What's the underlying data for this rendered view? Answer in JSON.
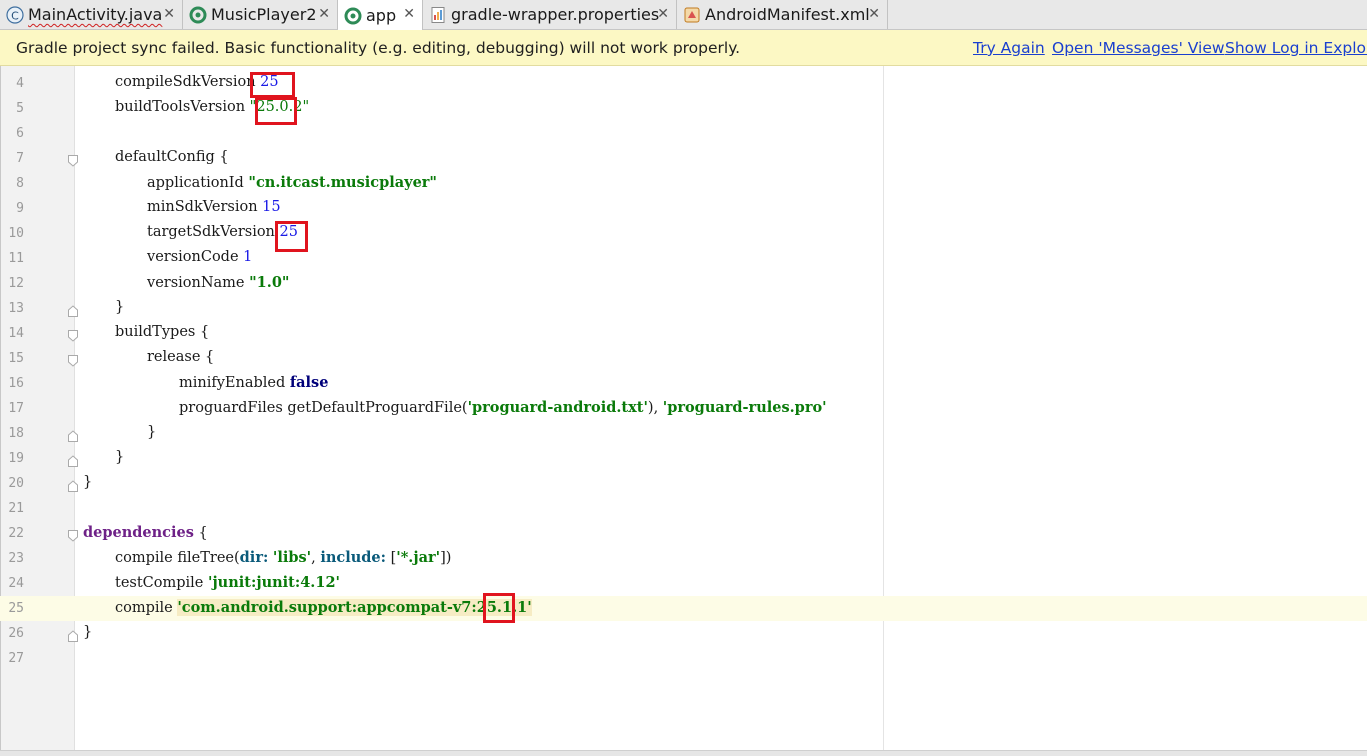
{
  "tabs": [
    {
      "label": "MainActivity.java",
      "icon": "class-c-icon",
      "active": false,
      "error": true
    },
    {
      "label": "MusicPlayer2",
      "icon": "gradle-module-icon",
      "active": false
    },
    {
      "label": "app",
      "icon": "gradle-module-icon",
      "active": true
    },
    {
      "label": "gradle-wrapper.properties",
      "icon": "properties-file-icon",
      "active": false
    },
    {
      "label": "AndroidManifest.xml",
      "icon": "manifest-file-icon",
      "active": false
    }
  ],
  "notification": {
    "message": "Gradle project sync failed. Basic functionality (e.g. editing, debugging) will not work properly.",
    "try_again": "Try Again",
    "open_messages": "Open 'Messages' View",
    "show_log": "Show Log in Explorer"
  },
  "line_numbers": [
    "4",
    "5",
    "6",
    "7",
    "8",
    "9",
    "10",
    "11",
    "12",
    "13",
    "14",
    "15",
    "16",
    "17",
    "18",
    "19",
    "20",
    "21",
    "22",
    "23",
    "24",
    "25",
    "26",
    "27"
  ],
  "code": {
    "l4": {
      "t1": "compileSdkVersion ",
      "n1": "25"
    },
    "l5": {
      "t1": "buildToolsVersion ",
      "s1": "\"25.0.2\""
    },
    "l7": {
      "t1": "defaultConfig {"
    },
    "l8": {
      "t1": "applicationId ",
      "s1": "\"cn.itcast.musicplayer\""
    },
    "l9": {
      "t1": "minSdkVersion ",
      "n1": "15"
    },
    "l10": {
      "t1": "targetSdkVersion ",
      "n1": "25"
    },
    "l11": {
      "t1": "versionCode ",
      "n1": "1"
    },
    "l12": {
      "t1": "versionName ",
      "s1": "\"1.0\""
    },
    "l13": {
      "t1": "}"
    },
    "l14": {
      "t1": "buildTypes {"
    },
    "l15": {
      "t1": "release {"
    },
    "l16": {
      "t1": "minifyEnabled ",
      "k1": "false"
    },
    "l17": {
      "t1": "proguardFiles getDefaultProguardFile(",
      "s1": "'proguard-android.txt'",
      "t2": "), ",
      "s2": "'proguard-rules.pro'"
    },
    "l18": {
      "t1": "}"
    },
    "l19": {
      "t1": "}"
    },
    "l20": {
      "t1": "}"
    },
    "l22": {
      "d1": "dependencies",
      "t1": " {"
    },
    "l23": {
      "t1": "compile fileTree(",
      "k1": "dir:",
      "t2": " ",
      "s1": "'libs'",
      "t3": ", ",
      "k2": "include:",
      "t4": " [",
      "s2": "'*.jar'",
      "t5": "])"
    },
    "l24": {
      "t1": "testCompile ",
      "s1": "'junit:junit:4.12'"
    },
    "l25": {
      "t1": "compile ",
      "s1": "'com.android.support:appcompat-v7:25.1.1'"
    },
    "l26": {
      "t1": "}"
    }
  },
  "colors": {
    "notification_bg": "#fcf8c4",
    "link": "#1a3fcf",
    "string": "#0a7a0a",
    "number": "#1a1ae6",
    "keyword": "#00007a",
    "highlight_box": "#e0141e"
  }
}
